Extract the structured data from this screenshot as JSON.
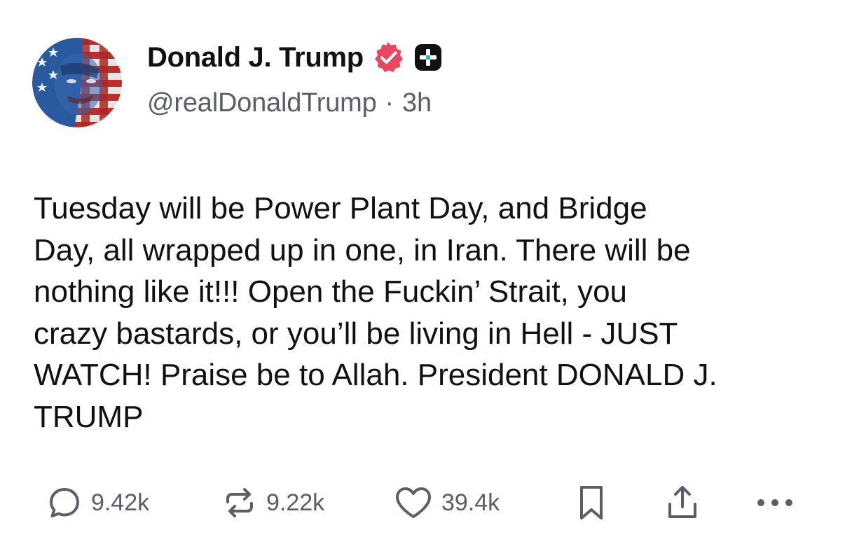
{
  "author": {
    "display_name": "Donald J. Trump",
    "handle": "@realDonaldTrump",
    "separator": "·",
    "time": "3h"
  },
  "post": {
    "text": "Tuesday will be Power Plant Day, and Bridge\nDay, all wrapped up in one, in Iran. There will be\nnothing like it!!! Open the Fuckin’ Strait, you\ncrazy bastards, or you’ll be living in Hell - JUST\nWATCH! Praise be to Allah. President DONALD J.\nTRUMP"
  },
  "actions": {
    "replies": "9.42k",
    "reposts": "9.22k",
    "likes": "39.4k"
  },
  "icons": {
    "verified": "verified-badge-icon",
    "plus": "plus-badge-icon",
    "reply": "reply-bubble-icon",
    "repost": "repost-arrows-icon",
    "like": "heart-icon",
    "bookmark": "bookmark-icon",
    "share": "share-upload-icon",
    "more": "more-dots-icon"
  },
  "colors": {
    "verified_badge": "#e8475f",
    "text_primary": "#111111",
    "text_secondary": "#5b5e66",
    "plus_badge_bg": "#111111"
  }
}
